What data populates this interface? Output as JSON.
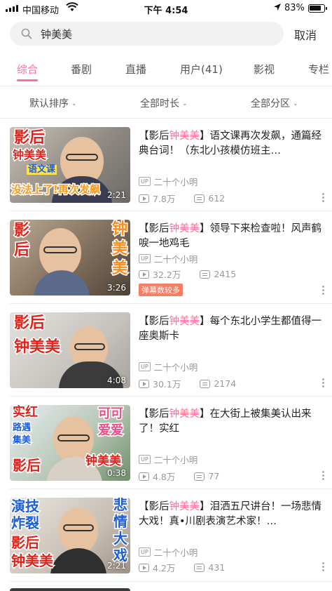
{
  "status_bar": {
    "carrier": "中国移动",
    "time": "下午 4:54",
    "battery": "83%"
  },
  "search": {
    "value": "钟美美",
    "cancel_label": "取消"
  },
  "tabs": [
    {
      "label": "综合",
      "active": true
    },
    {
      "label": "番剧",
      "active": false
    },
    {
      "label": "直播",
      "active": false
    },
    {
      "label": "用户(41)",
      "active": false
    },
    {
      "label": "影视",
      "active": false
    },
    {
      "label": "专栏",
      "active": false
    }
  ],
  "filters": [
    {
      "label": "默认排序"
    },
    {
      "label": "全部时长"
    },
    {
      "label": "全部分区"
    }
  ],
  "results": [
    {
      "title_prefix": "【影后",
      "title_highlight": "钟美美",
      "title_suffix": "】语文课再次发飙，通篇经典台词！（东北小孩模仿班主…",
      "uploader": "二十个小明",
      "views": "7.8万",
      "danmaku": "612",
      "duration": "2:21",
      "badge": "",
      "thumb_captions": [
        "影后",
        "钟美美",
        "语文课",
        "没法上了!再次发飙"
      ]
    },
    {
      "title_prefix": "【影后",
      "title_highlight": "钟美美",
      "title_suffix": "】领导下来检查啦！风声鹤唳一地鸡毛",
      "uploader": "二十个小明",
      "views": "32.2万",
      "danmaku": "2415",
      "duration": "3:26",
      "badge": "弹幕数较多",
      "thumb_captions": [
        "影",
        "后",
        "钟",
        "美",
        "美"
      ]
    },
    {
      "title_prefix": "【影后",
      "title_highlight": "钟美美",
      "title_suffix": "】每个东北小学生都值得一座奥斯卡",
      "uploader": "二十个小明",
      "views": "30.1万",
      "danmaku": "2174",
      "duration": "4:08",
      "badge": "",
      "thumb_captions": [
        "影后",
        "钟美美"
      ]
    },
    {
      "title_prefix": "【影后",
      "title_highlight": "钟美美",
      "title_suffix": "】在大街上被集美认出来了！实红",
      "uploader": "二十个小明",
      "views": "4.8万",
      "danmaku": "77",
      "duration": "0:38",
      "badge": "",
      "thumb_captions": [
        "实红",
        "路遇",
        "集美",
        "影后",
        "可可",
        "爱爱",
        "钟美美"
      ]
    },
    {
      "title_prefix": "【影后",
      "title_highlight": "钟美美",
      "title_suffix": "】泪洒五尺讲台！一场悲情大戏！真•川剧表演艺术家！…",
      "uploader": "二十个小明",
      "views": "4.2万",
      "danmaku": "431",
      "duration": "2:21",
      "badge": "",
      "thumb_captions": [
        "演技",
        "炸裂",
        "影后",
        "钟美美",
        "悲",
        "情",
        "大",
        "戏"
      ]
    }
  ],
  "colors": {
    "accent": "#fb7299",
    "badge": "#f77d63"
  },
  "icons": {
    "search": "search-icon",
    "up_badge": "up-badge-icon",
    "views": "play-count-icon",
    "danmaku": "danmaku-icon",
    "more": "more-vertical-icon"
  }
}
